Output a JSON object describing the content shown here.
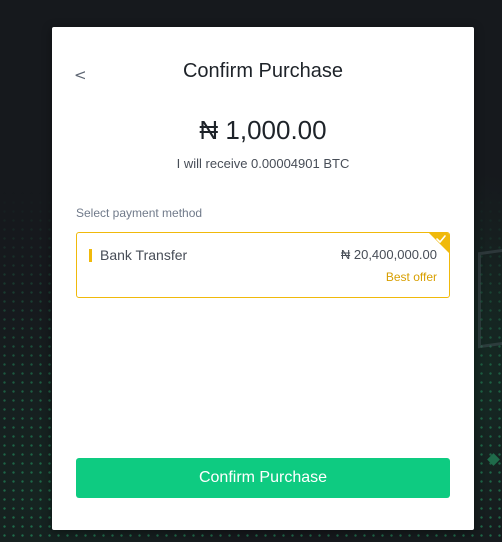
{
  "modal": {
    "title": "Confirm Purchase",
    "back_icon": "chevron-left-icon",
    "amount": "₦ 1,000.00",
    "receive_text": "I will receive 0.00004901 BTC",
    "payment_label": "Select payment method",
    "payment_method": {
      "name": "Bank Transfer",
      "price": "₦ 20,400,000.00",
      "badge": "Best offer",
      "selected": true,
      "selected_icon": "check-icon"
    },
    "confirm_label": "Confirm Purchase"
  },
  "colors": {
    "accent_yellow": "#f0b90b",
    "best_offer": "#d89f00",
    "confirm_green": "#0ecb81",
    "text_primary": "#1e2329",
    "text_secondary": "#474d57",
    "label_gray": "#707a8a"
  }
}
